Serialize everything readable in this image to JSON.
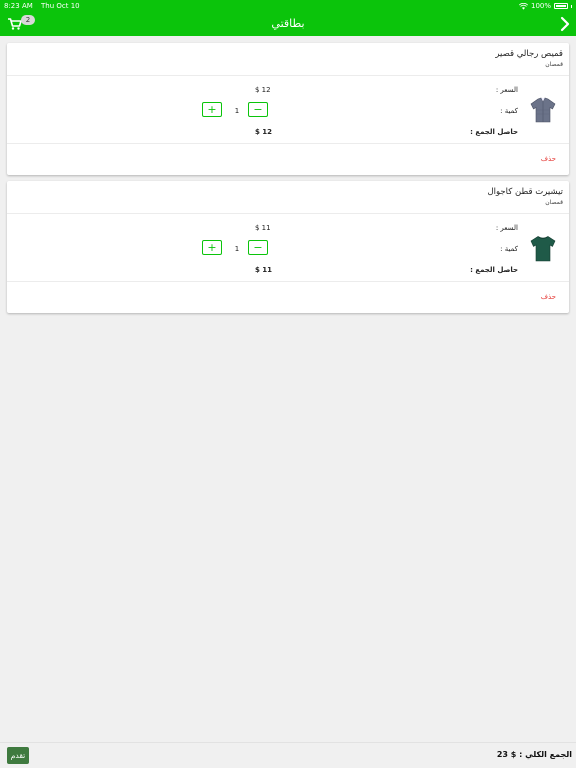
{
  "status_bar": {
    "time": "8:23 AM",
    "date": "Thu Oct 10",
    "battery": "100%",
    "icons": [
      "wifi-icon",
      "battery-icon"
    ]
  },
  "nav": {
    "title": "بطاقتي",
    "cart_badge": "2",
    "icons": [
      "cart-icon",
      "chevron-right-icon"
    ]
  },
  "items": [
    {
      "name": "قميص رجالي قصير",
      "category": "قمصان",
      "price_label": "السعر :",
      "price": "$ 12",
      "qty_label": "كمية :",
      "qty": "1",
      "subtotal_label": "حاصل الجمع :",
      "subtotal": "$ 12",
      "delete_label": "حذف",
      "image": "shirt-icon"
    },
    {
      "name": "تيشيرت قطن كاجوال",
      "category": "قمصان",
      "price_label": "السعر :",
      "price": "$ 11",
      "qty_label": "كمية :",
      "qty": "1",
      "subtotal_label": "حاصل الجمع :",
      "subtotal": "$ 11",
      "delete_label": "حذف",
      "image": "tshirt-icon"
    }
  ],
  "footer": {
    "total_label": "الجمع الكلي :",
    "total_value": "$ 23",
    "proceed_label": "تقدم"
  },
  "colors": {
    "accent": "#0bc40b",
    "delete": "#e53935",
    "proceed": "#3f7a3f"
  }
}
